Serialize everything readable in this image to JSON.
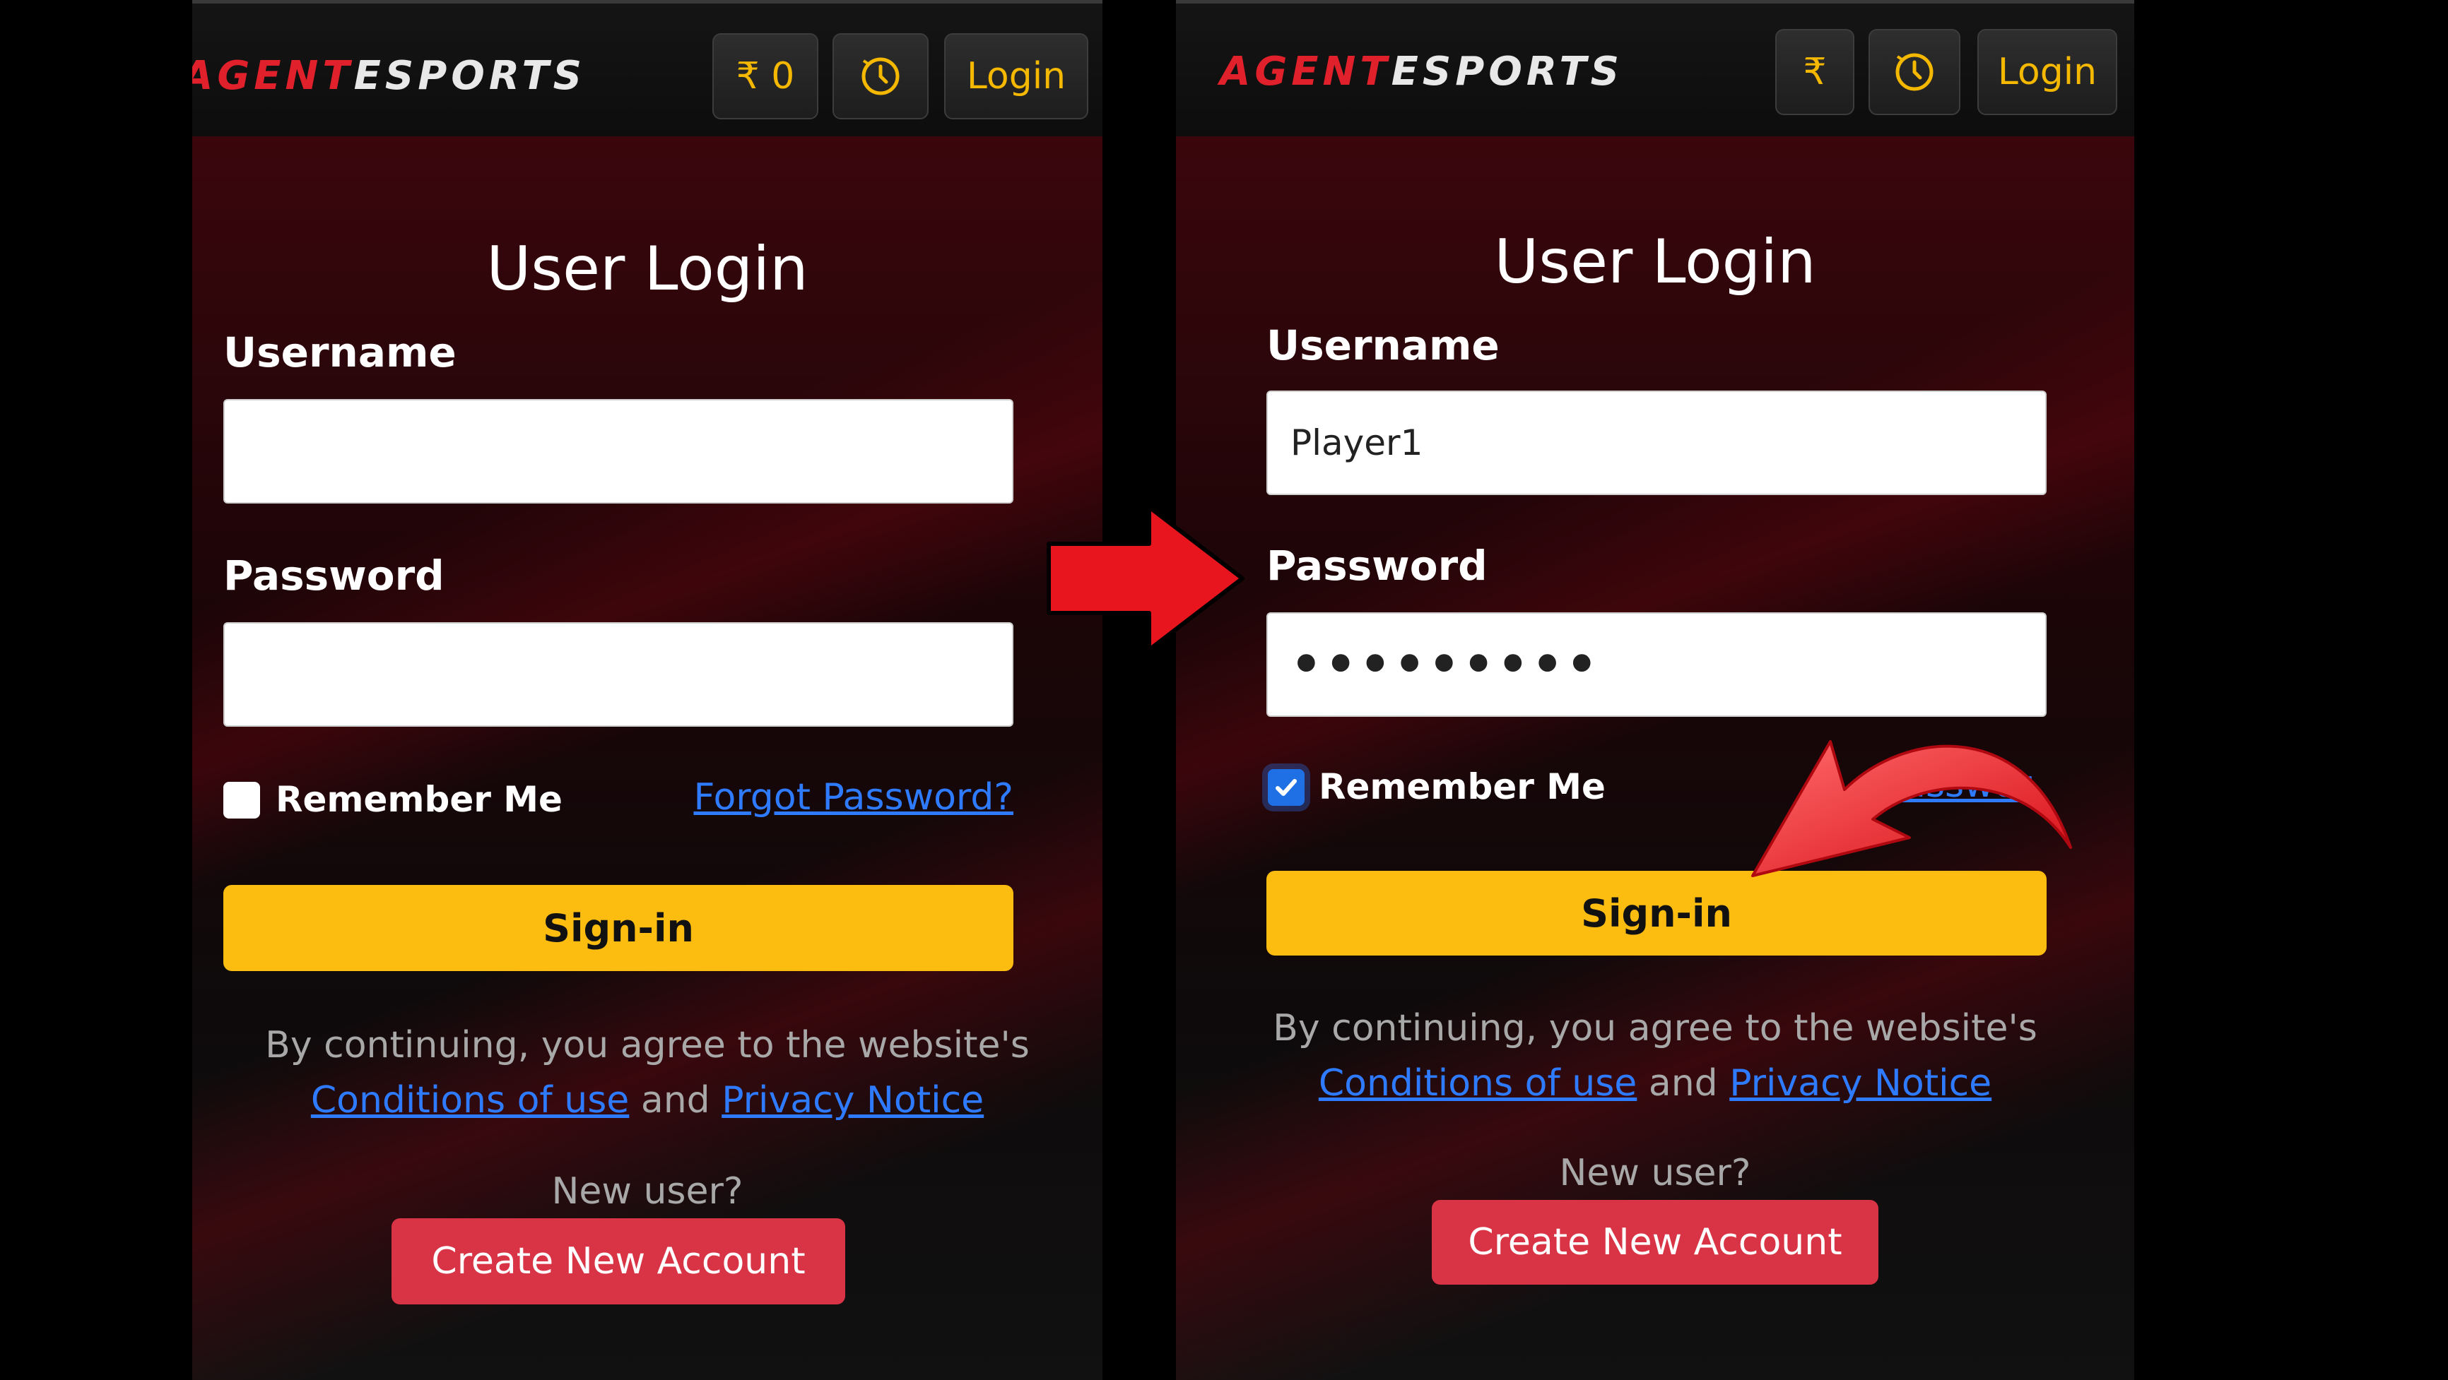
{
  "left": {
    "brand": {
      "part1": "AGENT",
      "part2": "ESPORTS"
    },
    "header": {
      "balance_label": "₹ 0",
      "history_icon": "clock-icon",
      "login_label": "Login"
    },
    "form": {
      "title": "User Login",
      "username_label": "Username",
      "username_value": "",
      "password_label": "Password",
      "password_value": "",
      "remember_label": "Remember Me",
      "remember_checked": false,
      "forgot_label": "Forgot Password?",
      "signin_label": "Sign-in"
    },
    "legal": {
      "prefix": "By continuing, you agree to the website's",
      "conditions": "Conditions of use",
      "and": "and",
      "privacy": "Privacy Notice"
    },
    "signup": {
      "prompt": "New user?",
      "button": "Create New Account"
    }
  },
  "right": {
    "brand": {
      "part1": "AGENT",
      "part2": "ESPORTS"
    },
    "header": {
      "balance_label": "₹",
      "history_icon": "clock-icon",
      "login_label": "Login"
    },
    "form": {
      "title": "User Login",
      "username_label": "Username",
      "username_value": "Player1",
      "password_label": "Password",
      "password_value": "•••••••••",
      "remember_label": "Remember Me",
      "remember_checked": true,
      "forgot_label": "Passwor",
      "signin_label": "Sign-in"
    },
    "legal": {
      "prefix": "By continuing, you agree to the website's",
      "conditions": "Conditions of use",
      "and": "and",
      "privacy": "Privacy Notice"
    },
    "signup": {
      "prompt": "New user?",
      "button": "Create New Account"
    }
  },
  "annotations": {
    "step_arrow": "red-right-arrow-icon",
    "pointer_arrow": "red-curved-arrow-icon",
    "color": "#e8141e"
  },
  "colors": {
    "brand_red": "#e0202a",
    "accent_yellow": "#fdbd10",
    "create_red": "#d93445",
    "link_blue": "#2f7bff",
    "checkbox_blue": "#1f6fe5"
  }
}
